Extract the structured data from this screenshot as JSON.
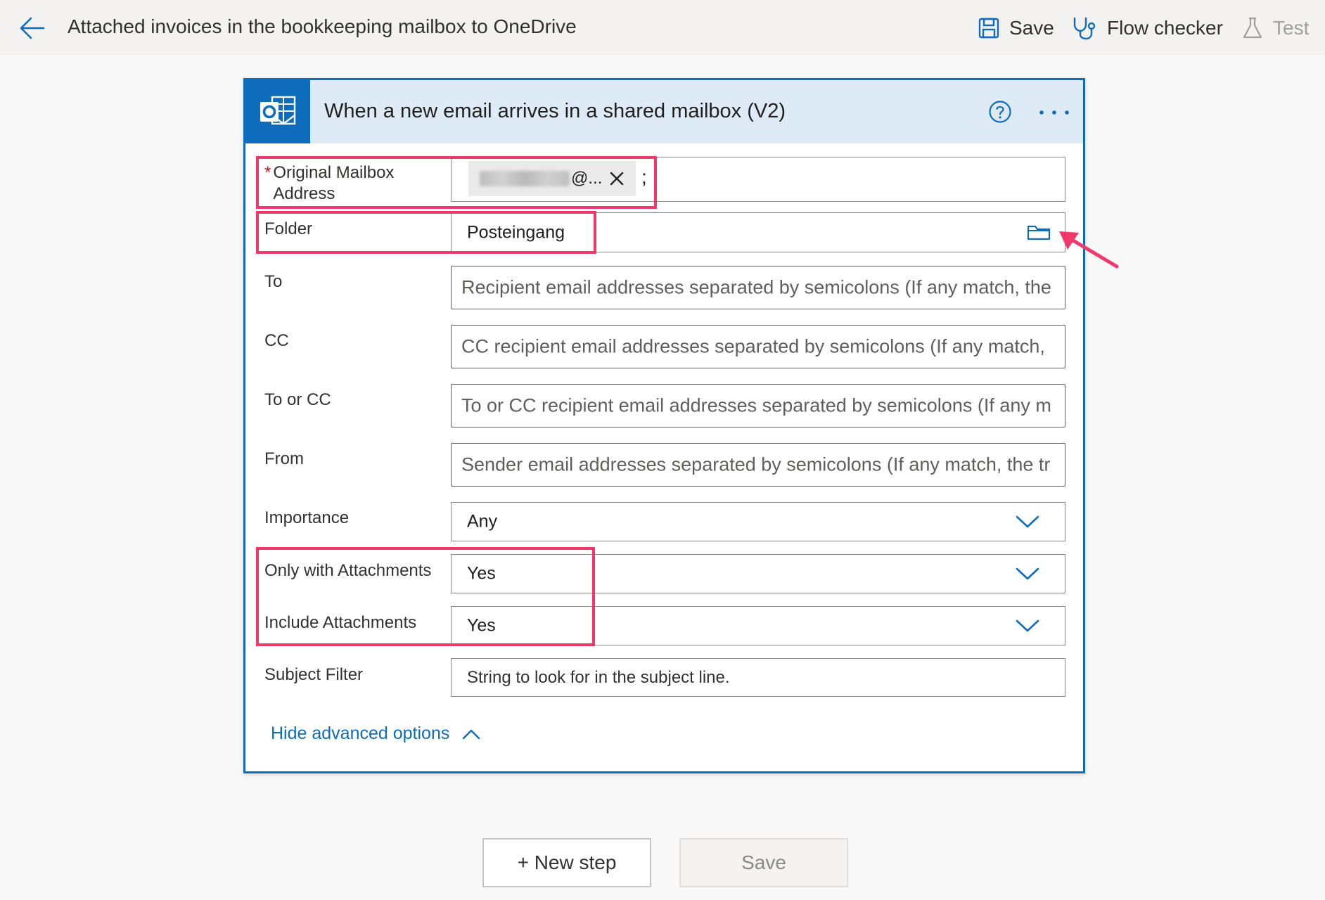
{
  "header": {
    "flow_title": "Attached invoices in the bookkeeping mailbox to OneDrive",
    "save_label": "Save",
    "flow_checker_label": "Flow checker",
    "test_label": "Test"
  },
  "trigger_card": {
    "title": "When a new email arrives in a shared mailbox (V2)",
    "fields": {
      "original_mailbox": {
        "label": "Original Mailbox Address",
        "required_marker": "*",
        "token_text": "@...",
        "separator": ";"
      },
      "folder": {
        "label": "Folder",
        "value": "Posteingang"
      },
      "to": {
        "label": "To",
        "placeholder": "Recipient email addresses separated by semicolons (If any match, the"
      },
      "cc": {
        "label": "CC",
        "placeholder": "CC recipient email addresses separated by semicolons (If any match,"
      },
      "to_or_cc": {
        "label": "To or CC",
        "placeholder": "To or CC recipient email addresses separated by semicolons (If any m"
      },
      "from": {
        "label": "From",
        "placeholder": "Sender email addresses separated by semicolons (If any match, the tr"
      },
      "importance": {
        "label": "Importance",
        "value": "Any"
      },
      "only_with_attachments": {
        "label": "Only with Attachments",
        "value": "Yes"
      },
      "include_attachments": {
        "label": "Include Attachments",
        "value": "Yes"
      },
      "subject_filter": {
        "label": "Subject Filter",
        "placeholder": "String to look for in the subject line."
      }
    },
    "advanced_toggle": "Hide advanced options"
  },
  "footer": {
    "new_step_label": "+ New step",
    "save_label": "Save"
  },
  "colors": {
    "accent": "#0f6cbd",
    "highlight": "#f0386b",
    "header_band": "#deeaf6"
  }
}
